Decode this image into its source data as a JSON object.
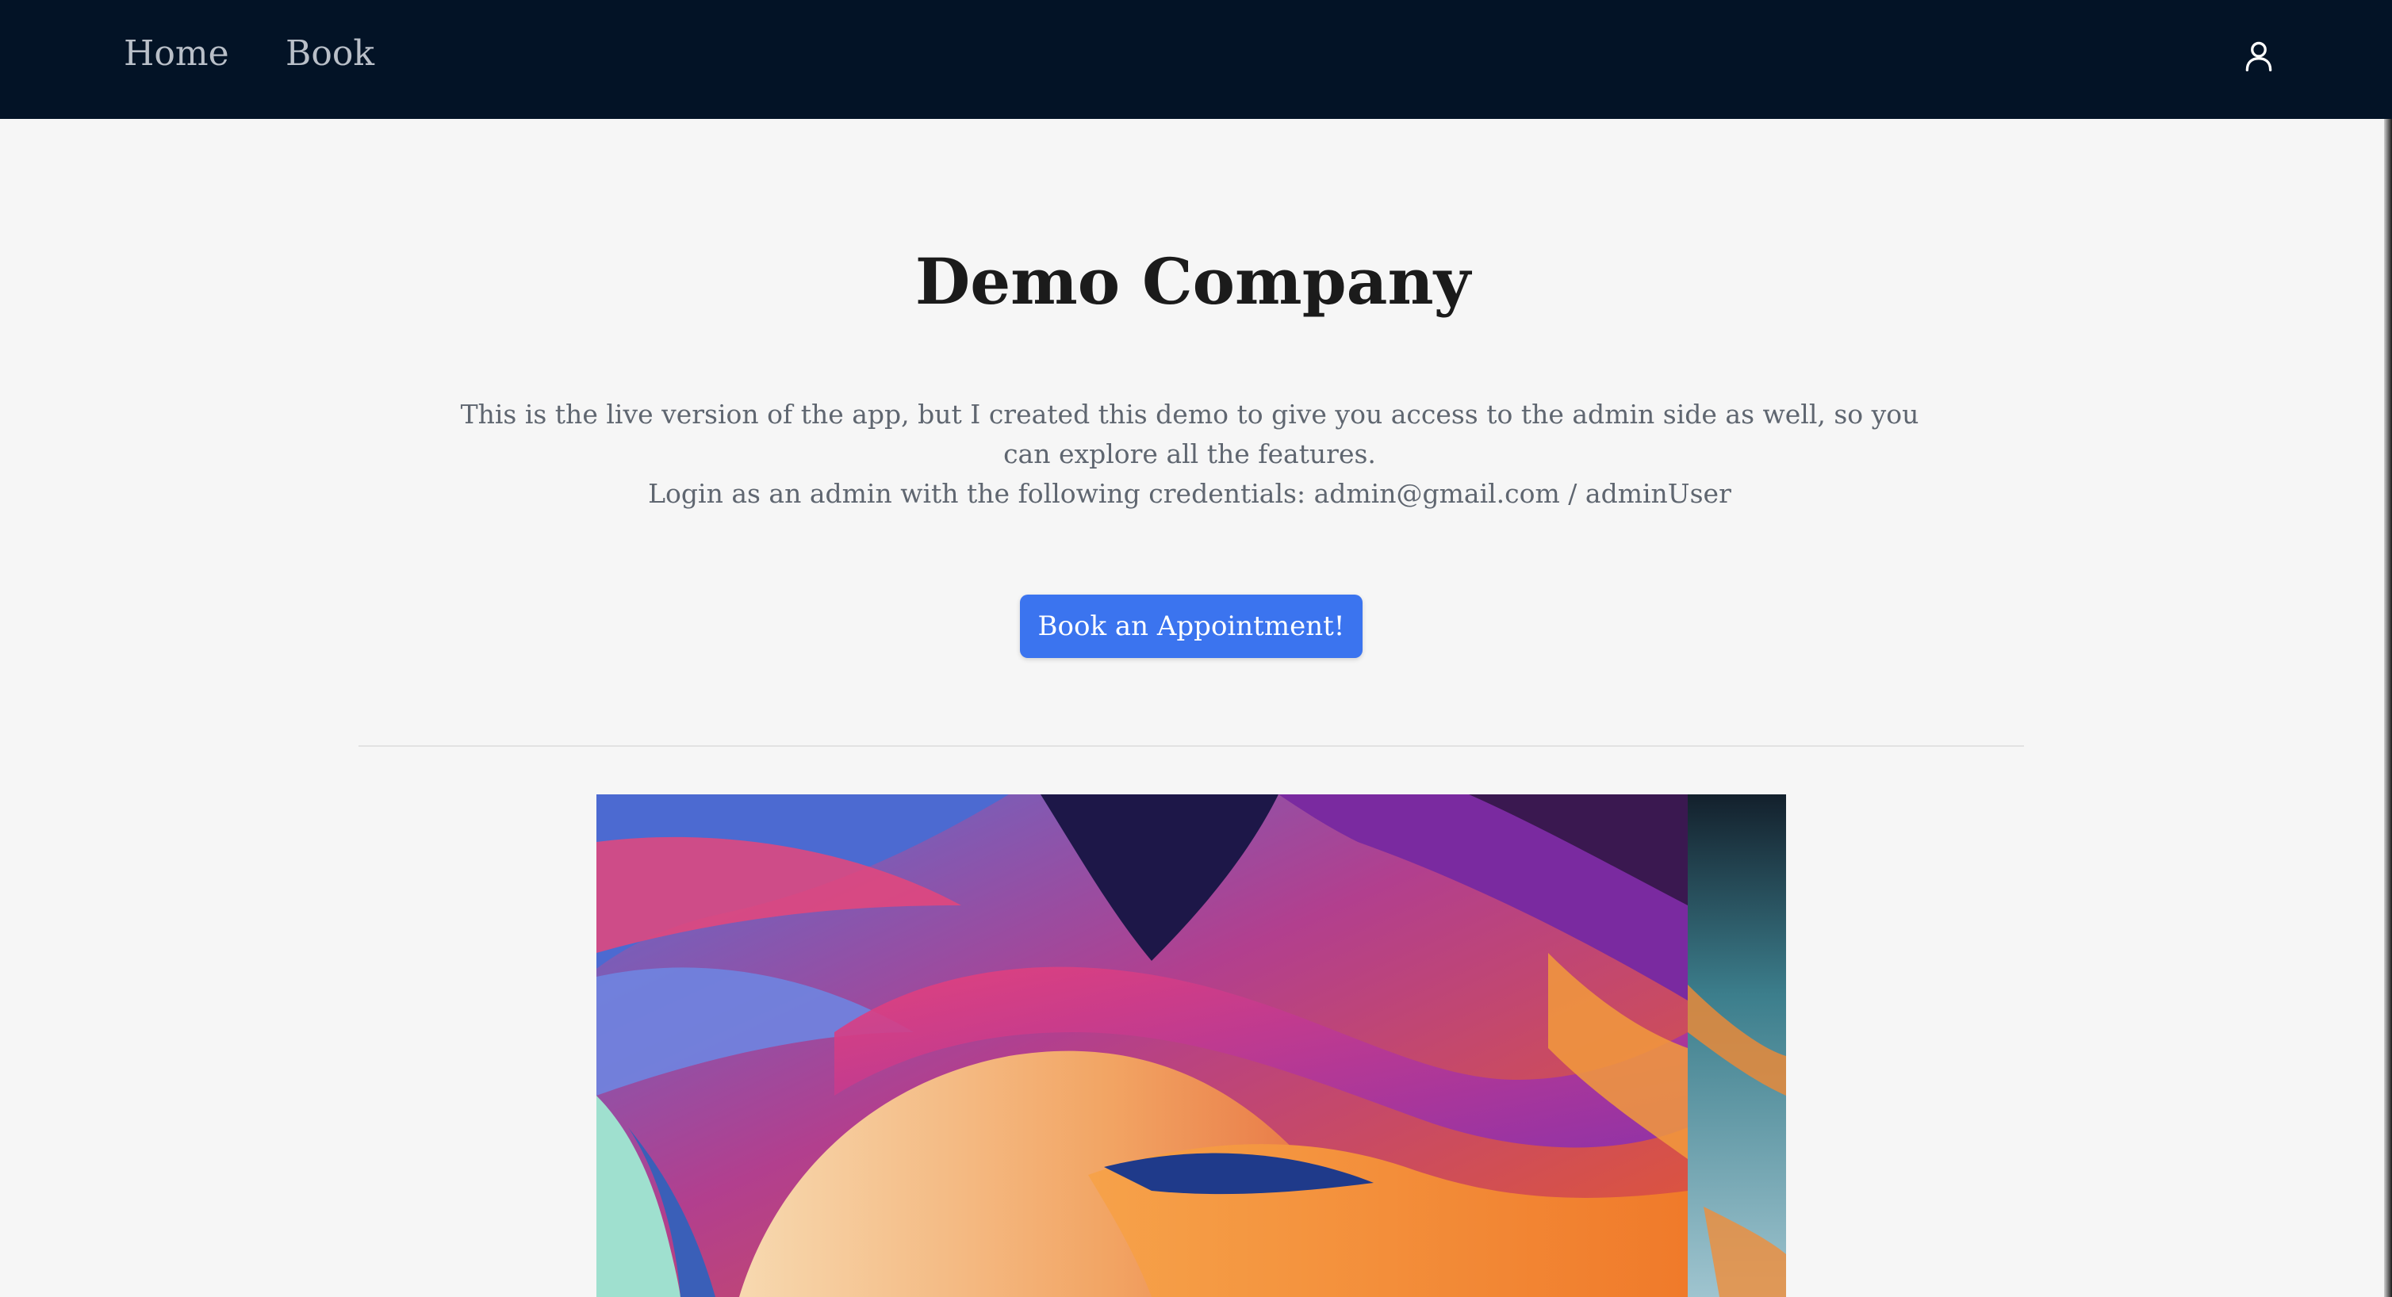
{
  "nav": {
    "links": [
      {
        "label": "Home"
      },
      {
        "label": "Book"
      }
    ],
    "profile_icon": "user-icon"
  },
  "hero": {
    "title": "Demo Company",
    "description_line1": "This is the live version of the app, but I created this demo to give you access to the admin side as well, so you can explore all the features.",
    "description_line2": "Login as an admin with the following credentials: admin@gmail.com / adminUser",
    "cta_label": "Book an Appointment!"
  },
  "colors": {
    "navbar": "#031326",
    "accent": "#3b74ef",
    "background": "#f6f6f6"
  }
}
